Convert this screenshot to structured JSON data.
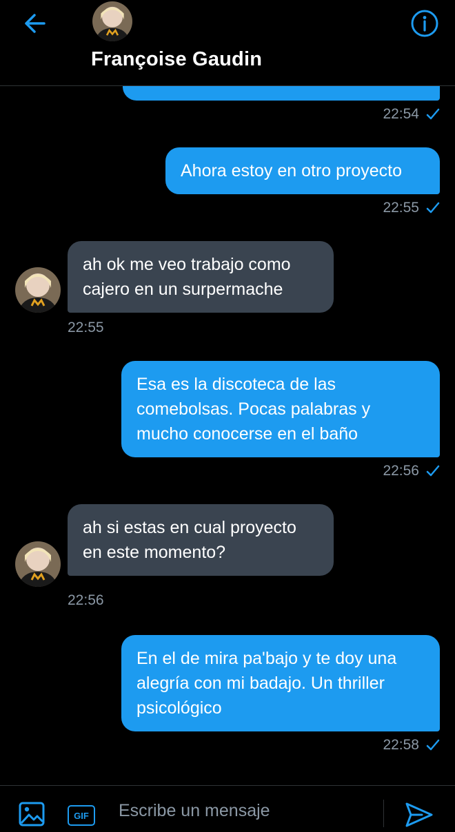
{
  "header": {
    "back_icon": "arrow-left-icon",
    "contact_name": "Françoise Gaudin",
    "info_icon": "info-icon"
  },
  "messages": [
    {
      "direction": "out",
      "lines": [
        ""
      ],
      "time": "22:54",
      "status_icon": "check-icon"
    },
    {
      "direction": "out",
      "lines": [
        "Ahora estoy en otro proyecto"
      ],
      "time": "22:55",
      "status_icon": "check-icon"
    },
    {
      "direction": "in",
      "lines": [
        "ah ok me veo trabajo como",
        "cajero en un surpermache"
      ],
      "time": "22:55"
    },
    {
      "direction": "out",
      "lines": [
        "Esa es la discoteca de las",
        "comebolsas. Pocas palabras y",
        "mucho conocerse en el baño"
      ],
      "time": "22:56",
      "status_icon": "check-icon"
    },
    {
      "direction": "in",
      "lines": [
        "ah si estas en cual proyecto",
        "en este momento?"
      ],
      "time": "22:56"
    },
    {
      "direction": "out",
      "lines": [
        "En el de mira pa'bajo y te doy una",
        "alegría con mi badajo. Un thriller",
        "psicológico"
      ],
      "time": "22:58",
      "status_icon": "check-icon"
    }
  ],
  "composer": {
    "media_icon": "image-icon",
    "gif_label": "GIF",
    "placeholder": "Escribe un mensaje",
    "send_icon": "send-icon"
  },
  "colors": {
    "accent": "#1d9bf0",
    "incoming_bubble": "#3a4450",
    "timestamp": "#8b98a5",
    "background": "#000000"
  }
}
